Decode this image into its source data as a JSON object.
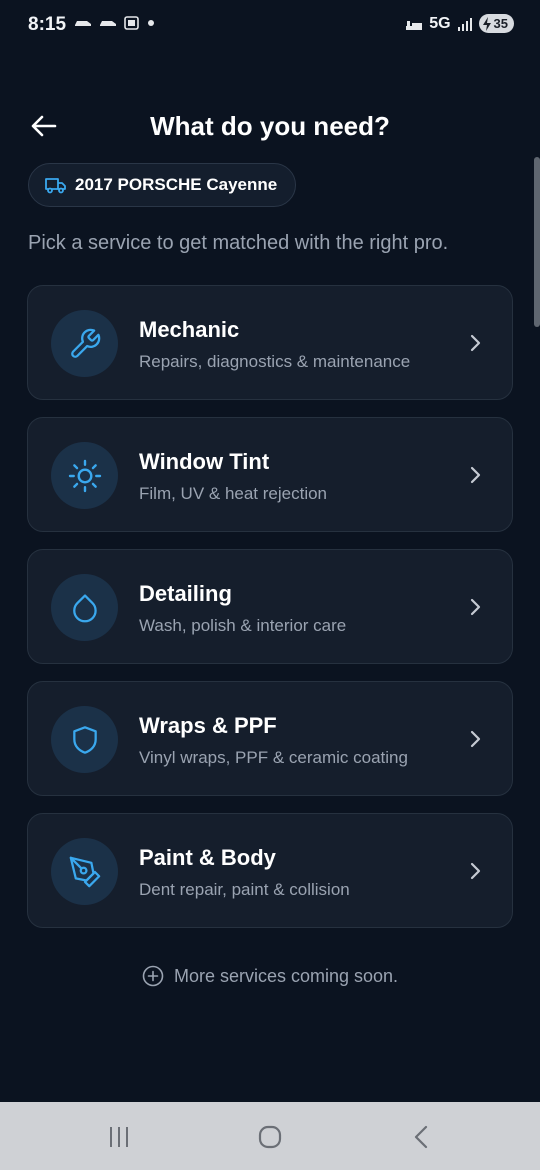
{
  "status_bar": {
    "time": "8:15",
    "network": "5G",
    "battery": "35"
  },
  "header": {
    "title": "What do you need?",
    "back_icon": "arrow-left-icon"
  },
  "vehicle": {
    "label": "2017 PORSCHE Cayenne",
    "icon": "truck-icon"
  },
  "subtitle": "Pick a service to get matched with the right pro.",
  "services": [
    {
      "title": "Mechanic",
      "description": "Repairs, diagnostics & maintenance",
      "icon": "wrench-icon"
    },
    {
      "title": "Window Tint",
      "description": "Film, UV & heat rejection",
      "icon": "sun-icon"
    },
    {
      "title": "Detailing",
      "description": "Wash, polish & interior care",
      "icon": "droplet-icon"
    },
    {
      "title": "Wraps & PPF",
      "description": "Vinyl wraps, PPF & ceramic coating",
      "icon": "shield-icon"
    },
    {
      "title": "Paint & Body",
      "description": "Dent repair, paint & collision",
      "icon": "pen-tool-icon"
    }
  ],
  "footer_note": "More services coming soon.",
  "colors": {
    "background": "#0b1320",
    "card": "#151e2c",
    "accent": "#3aa8ee",
    "muted_text": "#9aa3b1"
  }
}
